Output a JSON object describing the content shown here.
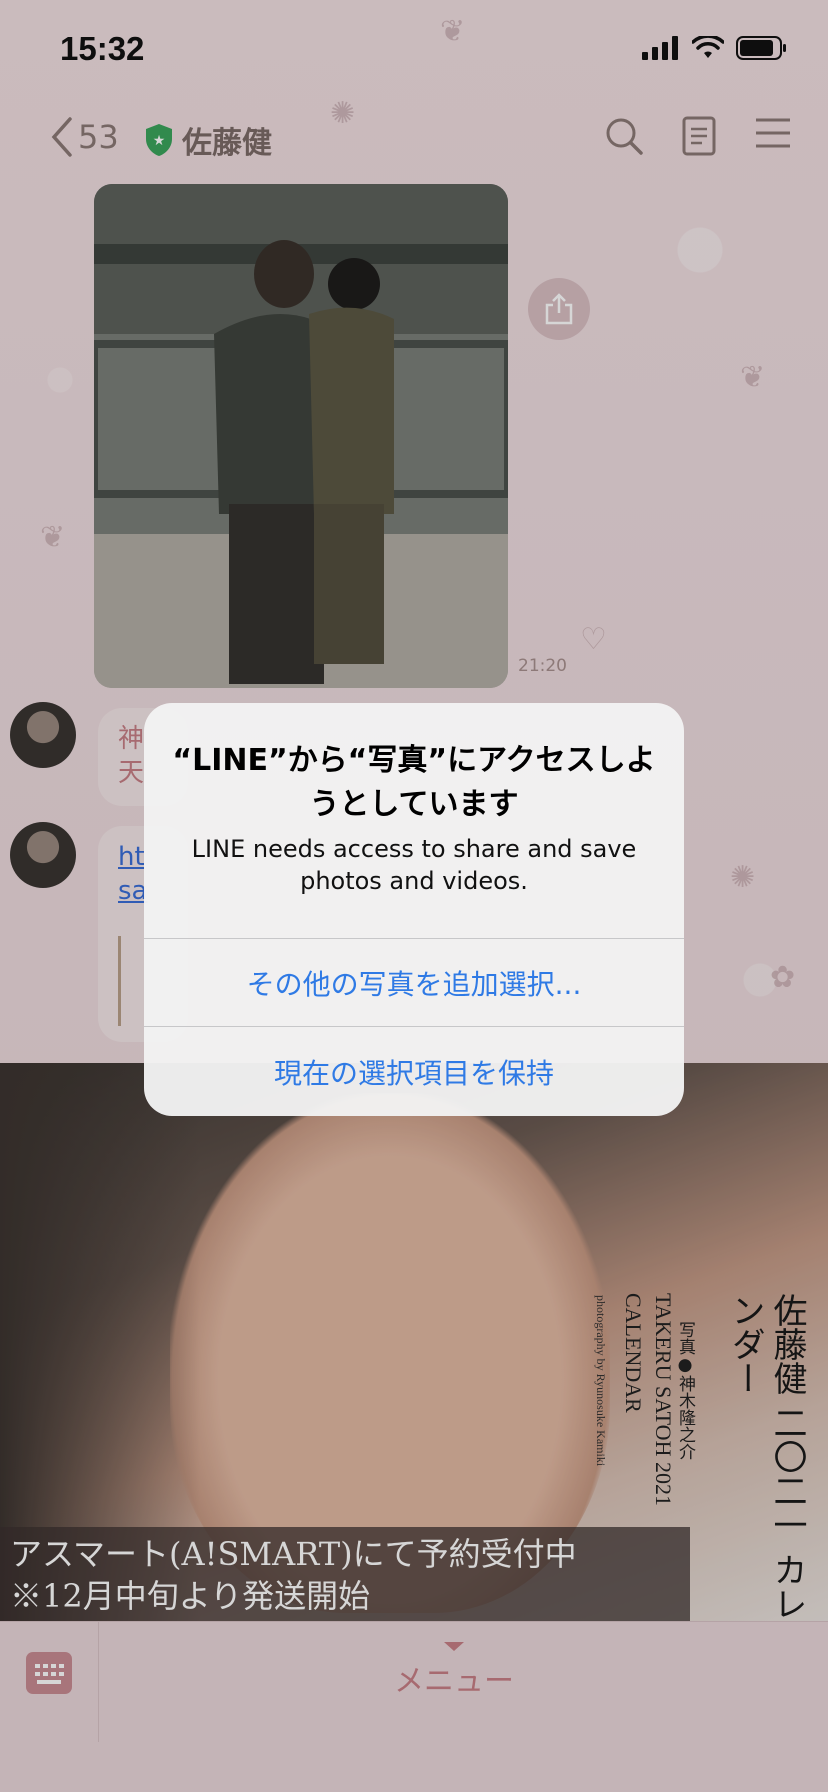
{
  "status_bar": {
    "time": "15:32"
  },
  "nav": {
    "back_count": "53",
    "chat_title": "佐藤健"
  },
  "chat": {
    "photo_time": "21:20",
    "message_1_preview": "神\n天",
    "message_2_link_preview": "ht\nsa"
  },
  "banner": {
    "title_vertical": "佐藤健 二〇二一 カレンダー",
    "photographer_jp": "写真●神木隆之介",
    "title_en": "TAKERU SATOH 2021 CALENDAR",
    "credit_en": "photography by Ryunosuke Kamiki",
    "caption_line1": "アスマート(A!SMART)にて予約受付中",
    "caption_line2": "※12月中旬より発送開始"
  },
  "bottom_bar": {
    "menu_label": "メニュー"
  },
  "alert": {
    "title": "“LINE”から“写真”にアクセスしようとしています",
    "message": "LINE needs access to share and save photos and videos.",
    "button_select_more": "その他の写真を追加選択...",
    "button_keep": "現在の選択項目を保持"
  },
  "colors": {
    "alert_button": "#2f7ae5",
    "accent_pink": "#c77f86",
    "verified_green": "#3ba55c"
  }
}
